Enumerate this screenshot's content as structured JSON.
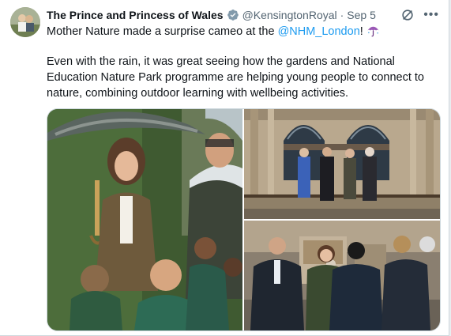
{
  "tweet": {
    "display_name": "The Prince and Princess of Wales",
    "handle": "@KensingtonRoyal",
    "separator": "·",
    "date": "Sep 5",
    "line1_prefix": "Mother Nature made a surprise cameo at the ",
    "mention": "@NHM_London",
    "line1_suffix": "!",
    "paragraph2": "Even with the rain, it was great seeing how the gardens and National Education Nature Park programme are helping young people to connect to nature, combining outdoor learning with wellbeing activities."
  },
  "icons": {
    "verified": "verified-badge-icon",
    "grok": "grok-icon",
    "more": "more-icon",
    "umbrella": "umbrella-rain-icon"
  },
  "colors": {
    "link": "#1d9bf0",
    "verified": "#829aab",
    "secondary_text": "#536471"
  }
}
